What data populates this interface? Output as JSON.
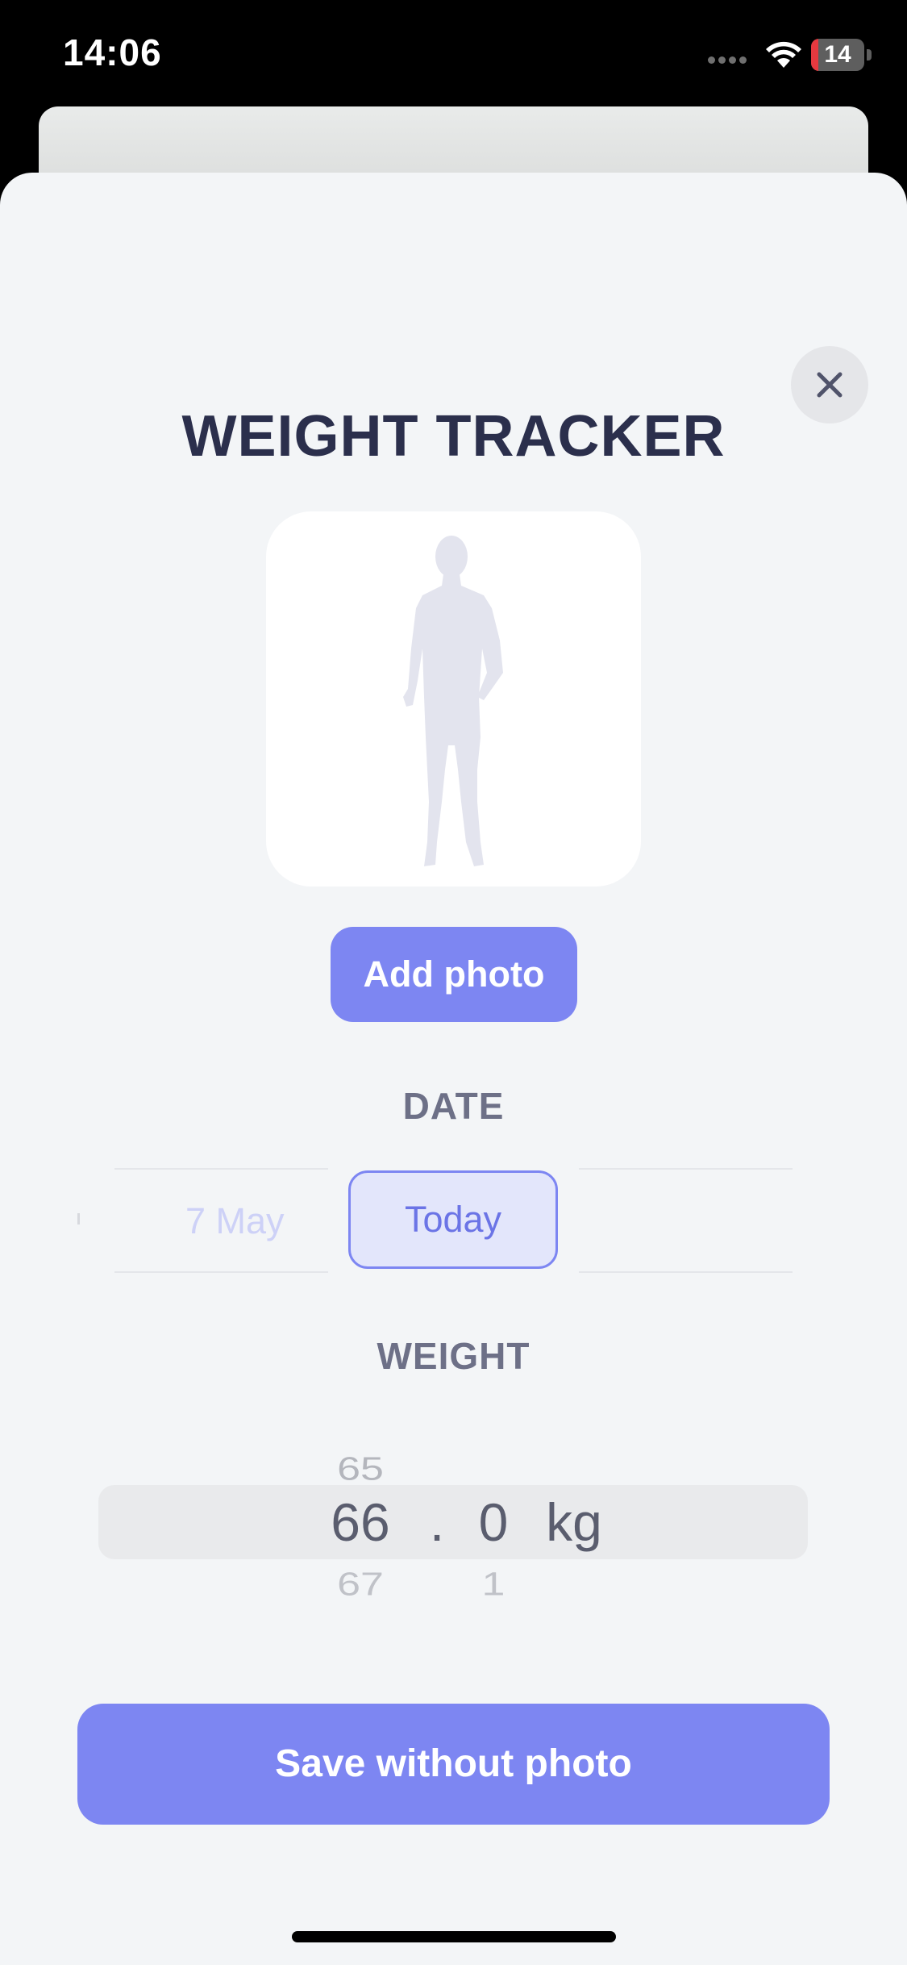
{
  "status_bar": {
    "time": "14:06",
    "battery_level": "14",
    "battery_color": "#e5393f",
    "icons": [
      "signal-dots-icon",
      "wifi-icon",
      "battery-icon"
    ]
  },
  "sheet": {
    "title": "WEIGHT TRACKER",
    "close_icon": "close-icon",
    "photo_placeholder_icon": "body-silhouette-icon",
    "add_photo_label": "Add photo"
  },
  "date": {
    "label": "DATE",
    "items": [
      {
        "label": "7 May",
        "selected": false
      },
      {
        "label": "Today",
        "selected": true
      }
    ]
  },
  "weight": {
    "label": "WEIGHT",
    "above": {
      "int": "65"
    },
    "selected": {
      "int": "66",
      "separator": ".",
      "decimal": "0",
      "unit": "kg"
    },
    "below": {
      "int": "67",
      "decimal": "1"
    }
  },
  "actions": {
    "save_label": "Save without photo"
  },
  "colors": {
    "accent": "#7d86f2",
    "title": "#2b2f4c",
    "sheet_background": "#f3f5f7"
  }
}
